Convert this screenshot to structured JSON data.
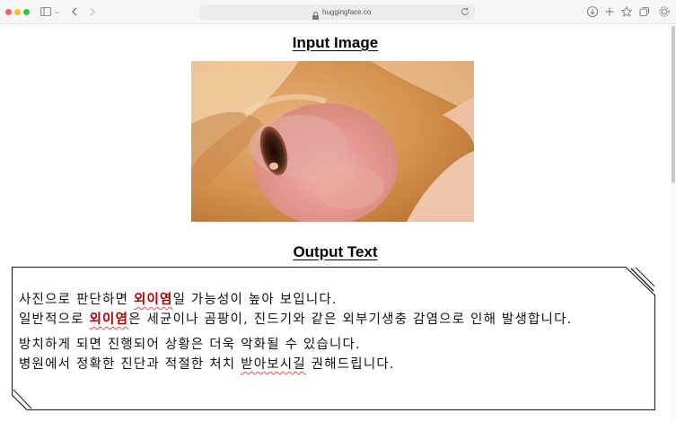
{
  "browser": {
    "url": "huggingface.co",
    "icons": [
      "sidebar-icon",
      "chevron-down-icon",
      "back-icon",
      "forward-icon",
      "lock-icon",
      "reload-icon",
      "download-icon",
      "plus-icon",
      "star-icon",
      "tabs-icon",
      "extensions-icon"
    ]
  },
  "page": {
    "input_title": "Input Image",
    "output_title": "Output Text",
    "output": {
      "line1": {
        "before": "사진으로 판단하면 ",
        "highlight": "외이염",
        "after": "일 가능성이 높아 보입니다."
      },
      "line2": {
        "before": "일반적으로 ",
        "highlight": "외이염",
        "after": "은 세균이나 곰팡이, 진드기와 같은 외부기생충 감염으로 인해 발생합니다."
      },
      "line3": {
        "text": "방치하게 되면 진행되어 상황은 더욱 악화될 수 있습니다."
      },
      "line4": {
        "before": "병원에서 정확한 진단과 적절한 처치 ",
        "squiggle": "받아보시길",
        "after": " 권해드립니다."
      }
    }
  },
  "colors": {
    "highlight": "#b00000",
    "spellcheck": "#e05050"
  }
}
